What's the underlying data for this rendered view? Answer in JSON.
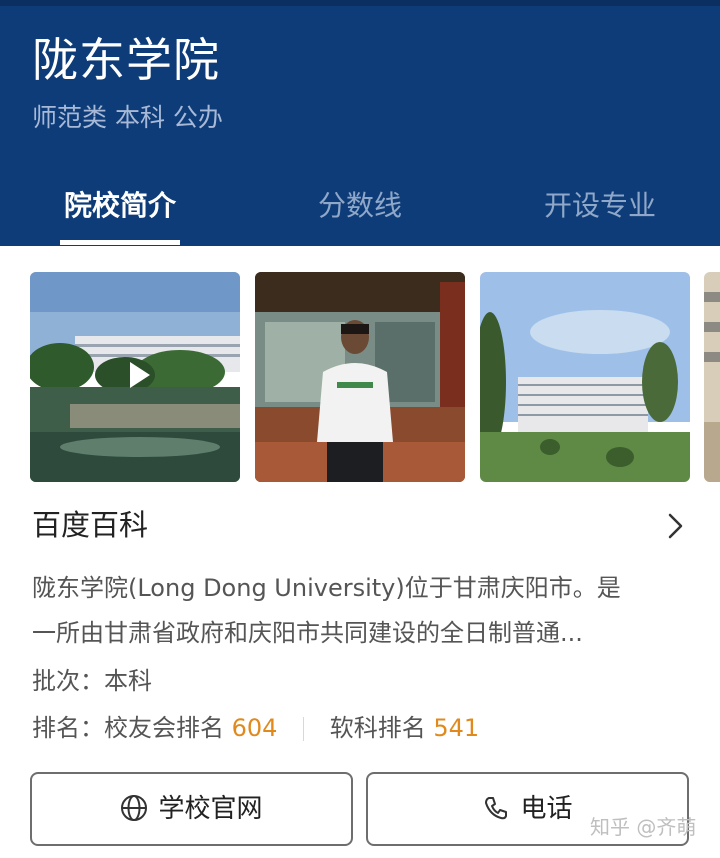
{
  "header": {
    "title": "陇东学院",
    "tags": "师范类  本科  公办"
  },
  "tabs": [
    {
      "label": "院校简介",
      "active": true
    },
    {
      "label": "分数线",
      "active": false
    },
    {
      "label": "开设专业",
      "active": false
    }
  ],
  "gallery": {
    "photos": [
      "campus-lake-video",
      "student-portrait",
      "campus-building",
      "building-partial"
    ]
  },
  "baike": {
    "title": "百度百科",
    "description_line1": "陇东学院(Long Dong University)位于甘肃庆阳市。是",
    "description_line2": "一所由甘肃省政府和庆阳市共同建设的全日制普通..."
  },
  "info": {
    "batch_label": "批次：",
    "batch_value": "本科",
    "rank_label": "排名：",
    "alumni_rank_label": "校友会排名",
    "alumni_rank_value": "604",
    "soft_rank_label": "软科排名",
    "soft_rank_value": "541"
  },
  "buttons": {
    "website_label": "学校官网",
    "phone_label": "电话"
  },
  "watermark": "知乎 @齐萌",
  "colors": {
    "header_bg": "#0e3c78",
    "accent_number": "#e08a1e"
  }
}
